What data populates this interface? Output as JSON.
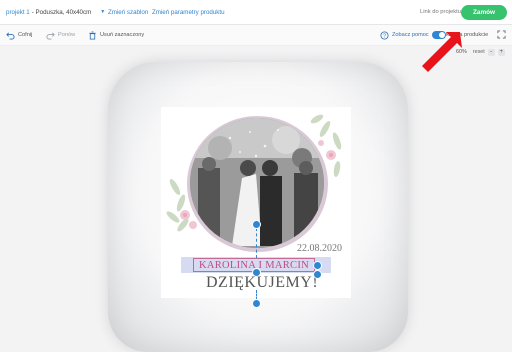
{
  "header": {
    "project_name": "projekt 1",
    "project_desc": "- Poduszka, 40x40cm",
    "change_template": "Zmień szablon",
    "change_params": "Zmień parametry produktu",
    "project_link": "Link do projektu",
    "order_button": "Zamów"
  },
  "toolbar": {
    "undo": "Cofnij",
    "redo": "Ponów",
    "delete_selected": "Usuń zaznaczony",
    "help": "Zobacz pomoc",
    "production_toggle": "kaz na produkcie"
  },
  "zoom": {
    "level": "60%",
    "reset": "reset",
    "minus": "-",
    "plus": "+"
  },
  "design": {
    "date": "22.08.2020",
    "names": "KAROLINA I MARCIN",
    "thanks": "DZIĘKUJEMY!"
  },
  "colors": {
    "accent": "#2f86d3",
    "order_green": "#37c26e",
    "name_text": "#c14b7e",
    "annotation_arrow": "#e8141b"
  },
  "icons": {
    "undo": "undo-icon",
    "redo": "redo-icon",
    "delete": "trash-icon",
    "help": "question-circle-icon",
    "expand": "fullscreen-icon"
  }
}
